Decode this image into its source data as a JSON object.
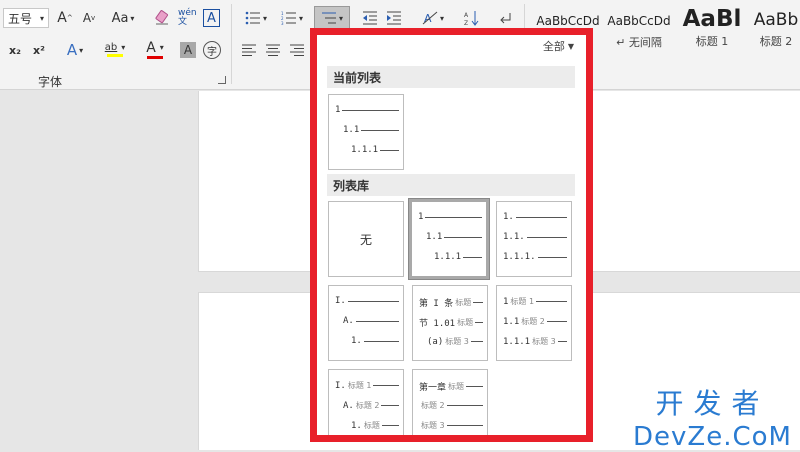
{
  "ribbon": {
    "font_size": "五号",
    "grow_font": "A",
    "shrink_font": "A",
    "change_case": "Aa",
    "phonetic": "wén文",
    "char_border": "A",
    "subscript": "x₂",
    "superscript": "x²",
    "text_effects": "A",
    "highlight": "ab",
    "font_color": "A",
    "char_shading": "A",
    "enclose": "字",
    "group_label": "字体",
    "styles": [
      {
        "sample": "AaBbCcDd",
        "name": ""
      },
      {
        "sample": "AaBbCcDd",
        "name": "↵ 无间隔"
      },
      {
        "sample": "AaBl",
        "name": "标题 1"
      },
      {
        "sample": "AaBb",
        "name": "标题 2"
      }
    ]
  },
  "dropdown": {
    "filter_label": "全部",
    "current_list_header": "当前列表",
    "library_header": "列表库",
    "none_label": "无",
    "current_tile": [
      {
        "text": "1",
        "indent": 0
      },
      {
        "text": "1.1",
        "indent": 1
      },
      {
        "text": "1.1.1",
        "indent": 2
      }
    ],
    "library": [
      {
        "rows": [
          {
            "text": "1",
            "indent": 0
          },
          {
            "text": "1.1",
            "indent": 1
          },
          {
            "text": "1.1.1",
            "indent": 2
          }
        ]
      },
      {
        "rows": [
          {
            "text": "1.",
            "indent": 0
          },
          {
            "text": "1.1.",
            "indent": 0
          },
          {
            "text": "1.1.1.",
            "indent": 0
          }
        ]
      },
      {
        "rows": [
          {
            "text": "I.",
            "indent": 0
          },
          {
            "text": "A.",
            "indent": 1
          },
          {
            "text": "1.",
            "indent": 2
          }
        ]
      },
      {
        "rows": [
          {
            "text": "第 I 条",
            "sub": "标题",
            "indent": 0
          },
          {
            "text": "节 1.01",
            "sub": "标题",
            "indent": 0
          },
          {
            "text": "(a)",
            "sub": "标题 3",
            "indent": 1
          }
        ]
      },
      {
        "rows": [
          {
            "text": "1",
            "sub": "标题 1",
            "indent": 0
          },
          {
            "text": "1.1",
            "sub": "标题 2",
            "indent": 0
          },
          {
            "text": "1.1.1",
            "sub": "标题 3",
            "indent": 0
          }
        ]
      },
      {
        "rows": [
          {
            "text": "I.",
            "sub": "标题 1",
            "indent": 0
          },
          {
            "text": "A.",
            "sub": "标题 2",
            "indent": 1
          },
          {
            "text": "1.",
            "sub": "标题",
            "indent": 2
          }
        ]
      },
      {
        "rows": [
          {
            "text": "第一章",
            "sub": "标题",
            "indent": 0
          },
          {
            "text": "",
            "sub": "标题 2",
            "indent": 0
          },
          {
            "text": "",
            "sub": "标题 3",
            "indent": 0
          }
        ]
      }
    ]
  },
  "watermark": {
    "line1": "开发者",
    "line2": "DevZe.CoM"
  },
  "colors": {
    "frame": "#e8202a",
    "watermark": "#2a7bd1"
  }
}
